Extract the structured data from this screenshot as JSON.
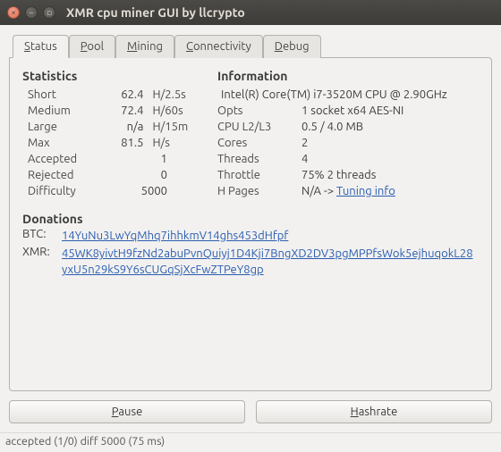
{
  "window": {
    "title": "XMR cpu miner GUI by llcrypto"
  },
  "tabs": {
    "status": {
      "prefix": "S",
      "rest": "tatus"
    },
    "pool": {
      "prefix": "P",
      "rest": "ool"
    },
    "mining": {
      "prefix": "M",
      "rest": "ining"
    },
    "connectivity": {
      "prefix": "C",
      "rest": "onnectivity"
    },
    "debug": {
      "prefix": "D",
      "rest": "ebug"
    }
  },
  "headings": {
    "statistics": "Statistics",
    "information": "Information",
    "donations": "Donations"
  },
  "stats": {
    "short": {
      "label": "Short",
      "value": "62.4",
      "unit": "H/2.5s"
    },
    "medium": {
      "label": "Medium",
      "value": "72.4",
      "unit": "H/60s"
    },
    "large": {
      "label": "Large",
      "value": "n/a",
      "unit": "H/15m"
    },
    "max": {
      "label": "Max",
      "value": "81.5",
      "unit": "H/s"
    },
    "accepted": {
      "label": "Accepted",
      "value": "1"
    },
    "rejected": {
      "label": "Rejected",
      "value": "0"
    },
    "difficulty": {
      "label": "Difficulty",
      "value": "5000"
    }
  },
  "info": {
    "cpu": {
      "value": "Intel(R) Core(TM) i7-3520M CPU @ 2.90GHz"
    },
    "opts": {
      "label": "Opts",
      "value": "1 socket x64 AES-NI"
    },
    "cache": {
      "label": "CPU L2/L3",
      "value": "0.5 / 4.0 MB"
    },
    "cores": {
      "label": "Cores",
      "value": "2"
    },
    "threads": {
      "label": "Threads",
      "value": "4"
    },
    "throttle": {
      "label": "Throttle",
      "value": "75% 2 threads"
    },
    "hpages": {
      "label": "H Pages",
      "prefix": "N/A -> ",
      "link": "Tuning info"
    }
  },
  "donations": {
    "btc": {
      "label": "BTC:",
      "addr": "14YuNu3LwYqMhq7ihhkmV14ghs453dHfpf"
    },
    "xmr": {
      "label": "XMR:",
      "addr": "45WK8yivtH9fzNd2abuPvnQuiyj1D4Kji7BngXD2DV3pgMPPfsWok5ejhuqokL28yxU5n29kS9Y6sCUGqSjXcFwZTPeY8gp"
    }
  },
  "buttons": {
    "pause": {
      "prefix": "P",
      "rest": "ause"
    },
    "hashrate": {
      "prefix": "H",
      "rest": "ashrate"
    }
  },
  "statusbar": {
    "text": "accepted (1/0) diff 5000 (75 ms)"
  }
}
